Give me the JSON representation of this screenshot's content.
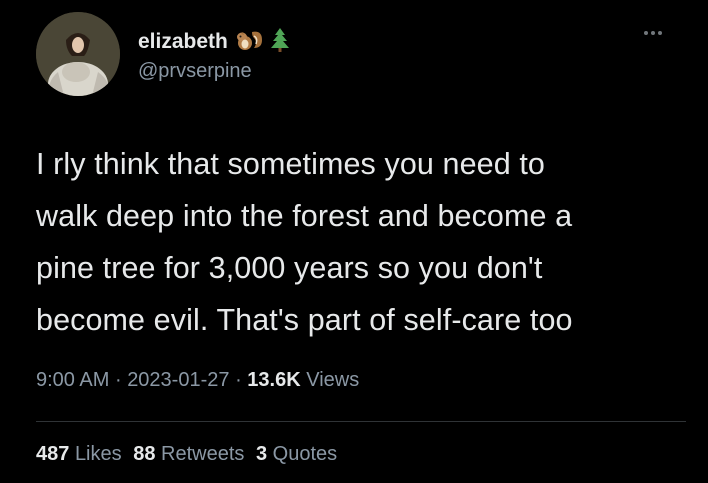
{
  "tweet": {
    "display_name": "elizabeth",
    "handle": "@prvserpine",
    "name_emojis": [
      "chipmunk-icon",
      "pine-tree-icon"
    ],
    "body_lines": [
      "I rly think that sometimes you need to",
      "walk deep into the forest and become a",
      "pine tree for 3,000 years so you don't",
      "become evil. That's part of self-care too"
    ],
    "time": "9:00 AM",
    "separator": "·",
    "date": "2023-01-27",
    "views_count": "13.6K",
    "views_label": "Views",
    "stats": [
      {
        "count": "487",
        "label": "Likes"
      },
      {
        "count": "88",
        "label": "Retweets"
      },
      {
        "count": "3",
        "label": "Quotes"
      }
    ]
  },
  "colors": {
    "background": "#000000",
    "primary_text": "#e7e9ea",
    "secondary_text": "#8b98a5",
    "divider": "#2f3336"
  }
}
